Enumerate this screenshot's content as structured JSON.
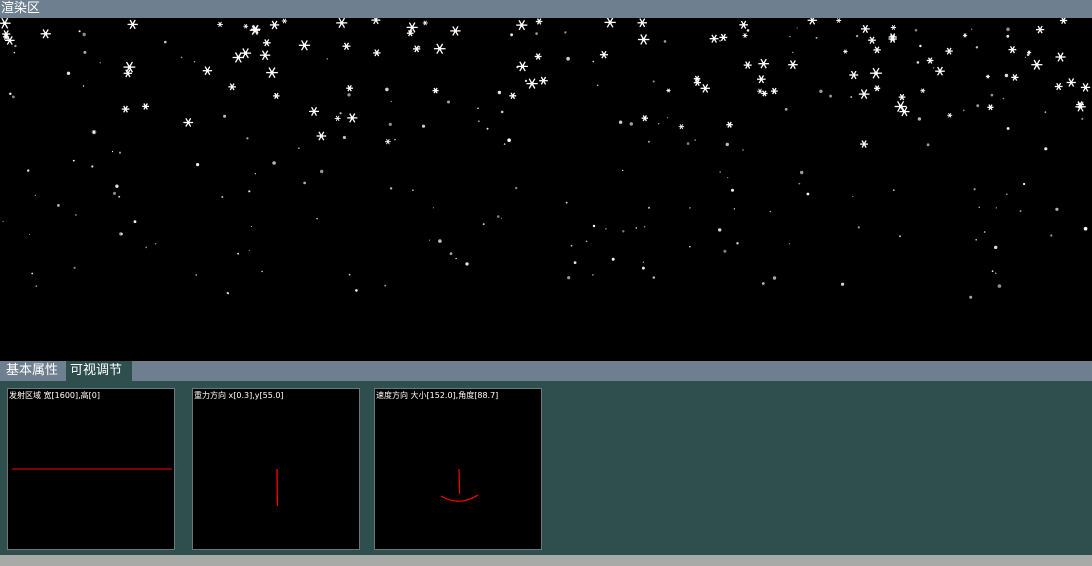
{
  "header": {
    "title": "渲染区"
  },
  "tabs": [
    {
      "label": "基本属性"
    },
    {
      "label": "可视调节区"
    }
  ],
  "panels": [
    {
      "caption": "发射区域 宽[1600],高[0]"
    },
    {
      "caption": "重力方向 x[0.3],y[55.0]"
    },
    {
      "caption": "速度方向 大小[152.0],角度[88.7]"
    }
  ],
  "colors": {
    "header_bg": "#6e8090",
    "panel_area_bg": "#2f4f4f",
    "indicator_line": "#ff0000",
    "snow": "#ffffff",
    "bottom_strip": "#a8aaa8"
  },
  "icons": {
    "snowflake": "snowflake-icon"
  }
}
